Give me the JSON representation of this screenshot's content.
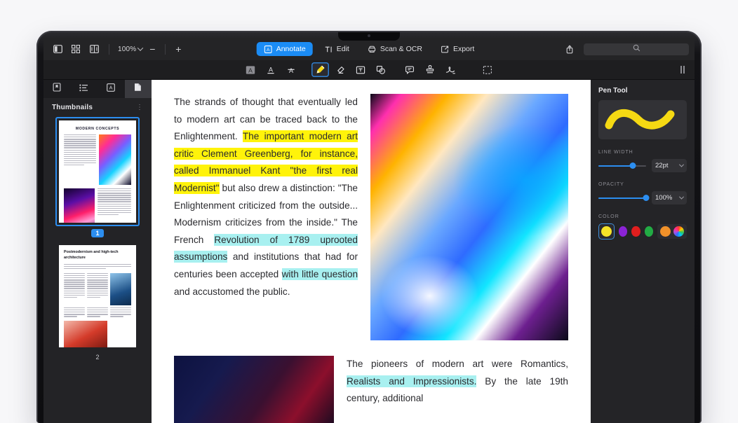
{
  "topbar": {
    "view_icons": [
      "sidebar-layout-icon",
      "grid-view-icon",
      "dual-page-icon"
    ],
    "zoom_value": "100%",
    "zoom_out_label": "−",
    "zoom_in_label": "+",
    "share_icon": "share-upload-icon",
    "search_icon": "search-icon",
    "search_placeholder": ""
  },
  "main_tabs": [
    {
      "label": "Annotate",
      "icon": "annotate-icon",
      "active": true
    },
    {
      "label": "Edit",
      "icon": "edit-text-icon",
      "active": false
    },
    {
      "label": "Scan & OCR",
      "icon": "scan-ocr-icon",
      "active": false
    },
    {
      "label": "Export",
      "icon": "export-icon",
      "active": false
    }
  ],
  "annotate_toolbar": {
    "tools": [
      {
        "name": "highlight-tool",
        "icon": "highlight-a-icon",
        "active": false
      },
      {
        "name": "underline-tool",
        "icon": "underline-a-icon",
        "active": false
      },
      {
        "name": "strikethrough-tool",
        "icon": "strikethrough-a-icon",
        "active": false
      },
      {
        "name": "pen-tool",
        "icon": "pen-marker-icon",
        "active": true
      },
      {
        "name": "eraser-tool",
        "icon": "eraser-icon",
        "active": false
      },
      {
        "name": "textbox-tool",
        "icon": "text-box-icon",
        "active": false
      },
      {
        "name": "shapes-tool",
        "icon": "shapes-icon",
        "active": false
      },
      {
        "name": "comment-tool",
        "icon": "comment-bubble-icon",
        "active": false
      },
      {
        "name": "stamp-tool",
        "icon": "stamp-icon",
        "active": false
      },
      {
        "name": "signature-tool",
        "icon": "signature-icon",
        "active": false
      },
      {
        "name": "crop-tool",
        "icon": "crop-select-icon",
        "active": false
      }
    ],
    "panel_toggle_icon": "panel-toggle-icon"
  },
  "sidebar": {
    "tabs": [
      {
        "name": "bookmarks-tab",
        "icon": "bookmark-icon",
        "active": false
      },
      {
        "name": "outline-tab",
        "icon": "list-outline-icon",
        "active": false
      },
      {
        "name": "annotations-tab",
        "icon": "annotation-a-icon",
        "active": false
      },
      {
        "name": "thumbnails-tab",
        "icon": "page-thumb-icon",
        "active": true
      }
    ],
    "title": "Thumbnails",
    "menu_icon": "more-options-icon",
    "pages": [
      {
        "number": "1",
        "title": "MODERN CONCEPTS",
        "selected": true
      },
      {
        "number": "2",
        "title": "Postmodernism and high-tech architecture",
        "selected": false
      }
    ]
  },
  "document": {
    "paragraph_1": {
      "runs": [
        {
          "text": "The strands of thought that eventually led to modern art can be traced back to the Enlightenment. ",
          "highlight": "none"
        },
        {
          "text": "The important modern art critic Clement Greenberg, for instance, called Immanuel Kant \"the first real Modernist\"",
          "highlight": "yellow"
        },
        {
          "text": " but also drew a distinction: \"The Enlightenment criticized from the outside... Modernism criticizes from the inside.\" The French ",
          "highlight": "none"
        },
        {
          "text": "Revolution of 1789 uprooted assumptions",
          "highlight": "cyan"
        },
        {
          "text": " and institutions that had for centuries been accepted ",
          "highlight": "none"
        },
        {
          "text": "with little question",
          "highlight": "cyan"
        },
        {
          "text": " and accustomed the public.",
          "highlight": "none"
        }
      ]
    },
    "paragraph_2": {
      "runs": [
        {
          "text": "The pioneers of modern art were Romantics, ",
          "highlight": "none"
        },
        {
          "text": "Realists and Impressionists.",
          "highlight": "cyan"
        },
        {
          "text": " By the late 19th century, additional",
          "highlight": "none"
        }
      ]
    },
    "images": [
      {
        "name": "prismatic-light-image",
        "alt": "abstract prismatic light streaks"
      },
      {
        "name": "dark-gradient-image",
        "alt": "dark blue and red gradient"
      }
    ]
  },
  "right_panel": {
    "title": "Pen Tool",
    "preview_icon": "pen-stroke-preview",
    "preview_color": "#f5d913",
    "line_width": {
      "label": "LINE WIDTH",
      "value": "22pt",
      "percent": 72
    },
    "opacity": {
      "label": "OPACITY",
      "value": "100%",
      "percent": 100
    },
    "color": {
      "label": "COLOR",
      "swatches": [
        {
          "name": "yellow",
          "hex": "#f5e328",
          "selected": true
        },
        {
          "name": "purple",
          "hex": "#8b23d6",
          "selected": false
        },
        {
          "name": "red",
          "hex": "#e01e1e",
          "selected": false
        },
        {
          "name": "green",
          "hex": "#22ab44",
          "selected": false
        }
      ],
      "recent": {
        "name": "orange",
        "hex": "#f0912a"
      },
      "picker_icon": "color-wheel-icon"
    }
  }
}
